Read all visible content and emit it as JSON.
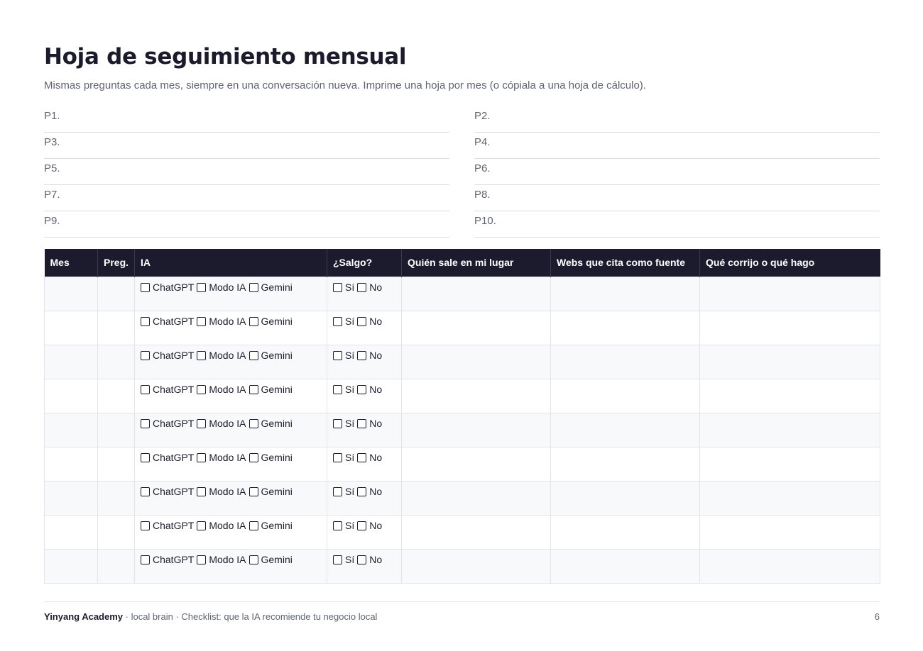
{
  "title": "Hoja de seguimiento mensual",
  "subtitle": "Mismas preguntas cada mes, siempre en una conversación nueva. Imprime una hoja por mes (o cópiala a una hoja de cálculo).",
  "questions": [
    "P1.",
    "P2.",
    "P3.",
    "P4.",
    "P5.",
    "P6.",
    "P7.",
    "P8.",
    "P9.",
    "P10."
  ],
  "table": {
    "headers": [
      "Mes",
      "Preg.",
      "IA",
      "¿Salgo?",
      "Quién sale en mi lugar",
      "Webs que cita como fuente",
      "Qué corrijo o qué hago"
    ],
    "ia_options": [
      "ChatGPT",
      "Modo IA",
      "Gemini"
    ],
    "salgo_options": [
      "Sí",
      "No"
    ],
    "row_count": 9
  },
  "footer": {
    "brand": "Yinyang Academy",
    "text": " · local brain · Checklist: que la IA recomiende tu negocio local",
    "page_number": "6"
  }
}
